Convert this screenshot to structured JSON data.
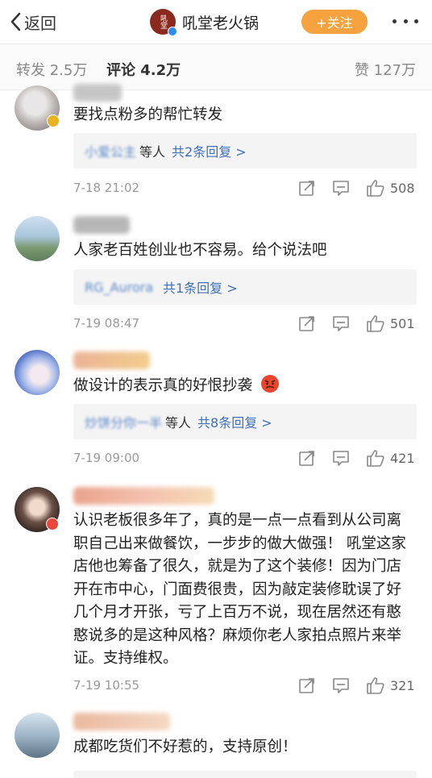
{
  "nav": {
    "back_label": "返回",
    "account_name": "吼堂老火锅",
    "logo_text": "吼堂",
    "follow_label": "+关注"
  },
  "stats": {
    "repost": "转发 2.5万",
    "comments": "评论 4.2万",
    "likes": "赞 127万"
  },
  "comments": [
    {
      "text": "要找点粉多的帮忙转发",
      "reply_prefix": "小爱公主",
      "reply_suffix": "等人",
      "reply_count": "共2条回复 >",
      "time": "7-18 21:02",
      "likes": "508"
    },
    {
      "text": "人家老百姓创业也不容易。给个说法吧",
      "reply_prefix": "RG_Aurora",
      "reply_suffix": "",
      "reply_count": "共1条回复 >",
      "time": "7-19 08:47",
      "likes": "501"
    },
    {
      "text": "做设计的表示真的好恨抄袭",
      "reply_prefix": "炒饼分你一半",
      "reply_suffix": "等人",
      "reply_count": "共8条回复 >",
      "time": "7-19 09:00",
      "likes": "421"
    },
    {
      "text": "认识老板很多年了，真的是一点一点看到从公司离职自己出来做餐饮，一步步的做大做强！ 吼堂这家店他也筹备了很久，就是为了这个装修！因为门店开在市中心，门面费很贵，因为敲定装修耽误了好几个月才开张，亏了上百万不说，现在居然还有憨憨说多的是这种风格？麻烦你老人家拍点照片来举证。支持维权。",
      "time": "7-19 10:55",
      "likes": "321"
    },
    {
      "text": "成都吃货们不好惹的，支持原创！"
    }
  ],
  "colors": {
    "follow_bg": "#f6a23e",
    "link_blue": "#3f6fb8",
    "vip_gold": "#e6b422",
    "vip_red": "#e8473a"
  }
}
